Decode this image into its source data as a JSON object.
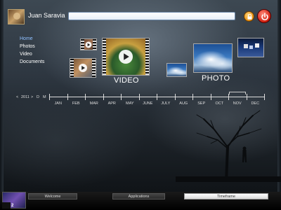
{
  "header": {
    "user_name": "Juan Saravia",
    "search_value": "",
    "lock_icon": "lock-icon",
    "power_icon": "power-icon",
    "colors": {
      "lock": "#e89010",
      "power": "#d22010",
      "accent": "#8fc0ff"
    }
  },
  "nav": {
    "items": [
      {
        "label": "Home",
        "active": true
      },
      {
        "label": "Photos",
        "active": false
      },
      {
        "label": "Video",
        "active": false
      },
      {
        "label": "Documents",
        "active": false
      }
    ]
  },
  "sections": {
    "video_label": "VIDEO",
    "photo_label": "PHOTO"
  },
  "timeline": {
    "prev": "<",
    "year": "2011",
    "next": ">",
    "view_d": "D",
    "view_m": "M",
    "months": [
      "JAN",
      "FEB",
      "MAR",
      "APR",
      "MAY",
      "JUNE",
      "JULY",
      "AUG",
      "SEP",
      "OCT",
      "NOV",
      "DEC"
    ],
    "selected_month": "NOV"
  },
  "taskbar": {
    "window_count": "2",
    "tabs": [
      {
        "label": "Welcome",
        "active": false
      },
      {
        "label": "Applications",
        "active": false
      },
      {
        "label": "Timeframe",
        "active": true
      }
    ]
  }
}
